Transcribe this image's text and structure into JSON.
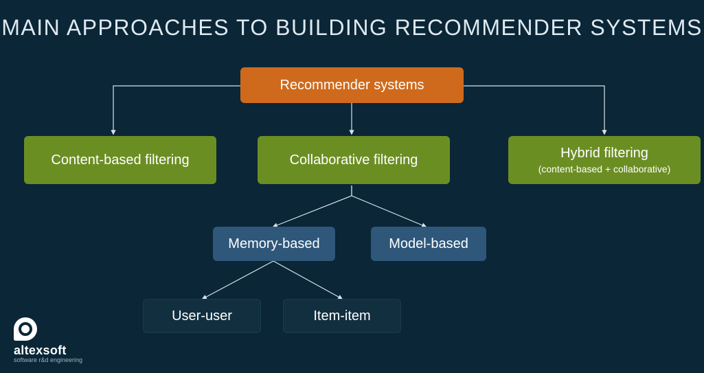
{
  "title": "MAIN APPROACHES TO BUILDING RECOMMENDER SYSTEMS",
  "root": {
    "label": "Recommender systems"
  },
  "level1": {
    "content": "Content-based filtering",
    "collab": "Collaborative filtering",
    "hybrid": "Hybrid filtering",
    "hybrid_sub": "(content-based + collaborative)"
  },
  "level2": {
    "memory": "Memory-based",
    "model": "Model-based"
  },
  "level3": {
    "useruser": "User-user",
    "itemitem": "Item-item"
  },
  "logo": {
    "name": "altexsoft",
    "tagline": "software r&d engineering"
  },
  "colors": {
    "bg": "#0a2637",
    "orange": "#cf6a1c",
    "green": "#6b8e23",
    "blue": "#2e577a",
    "dark": "#122f40"
  }
}
